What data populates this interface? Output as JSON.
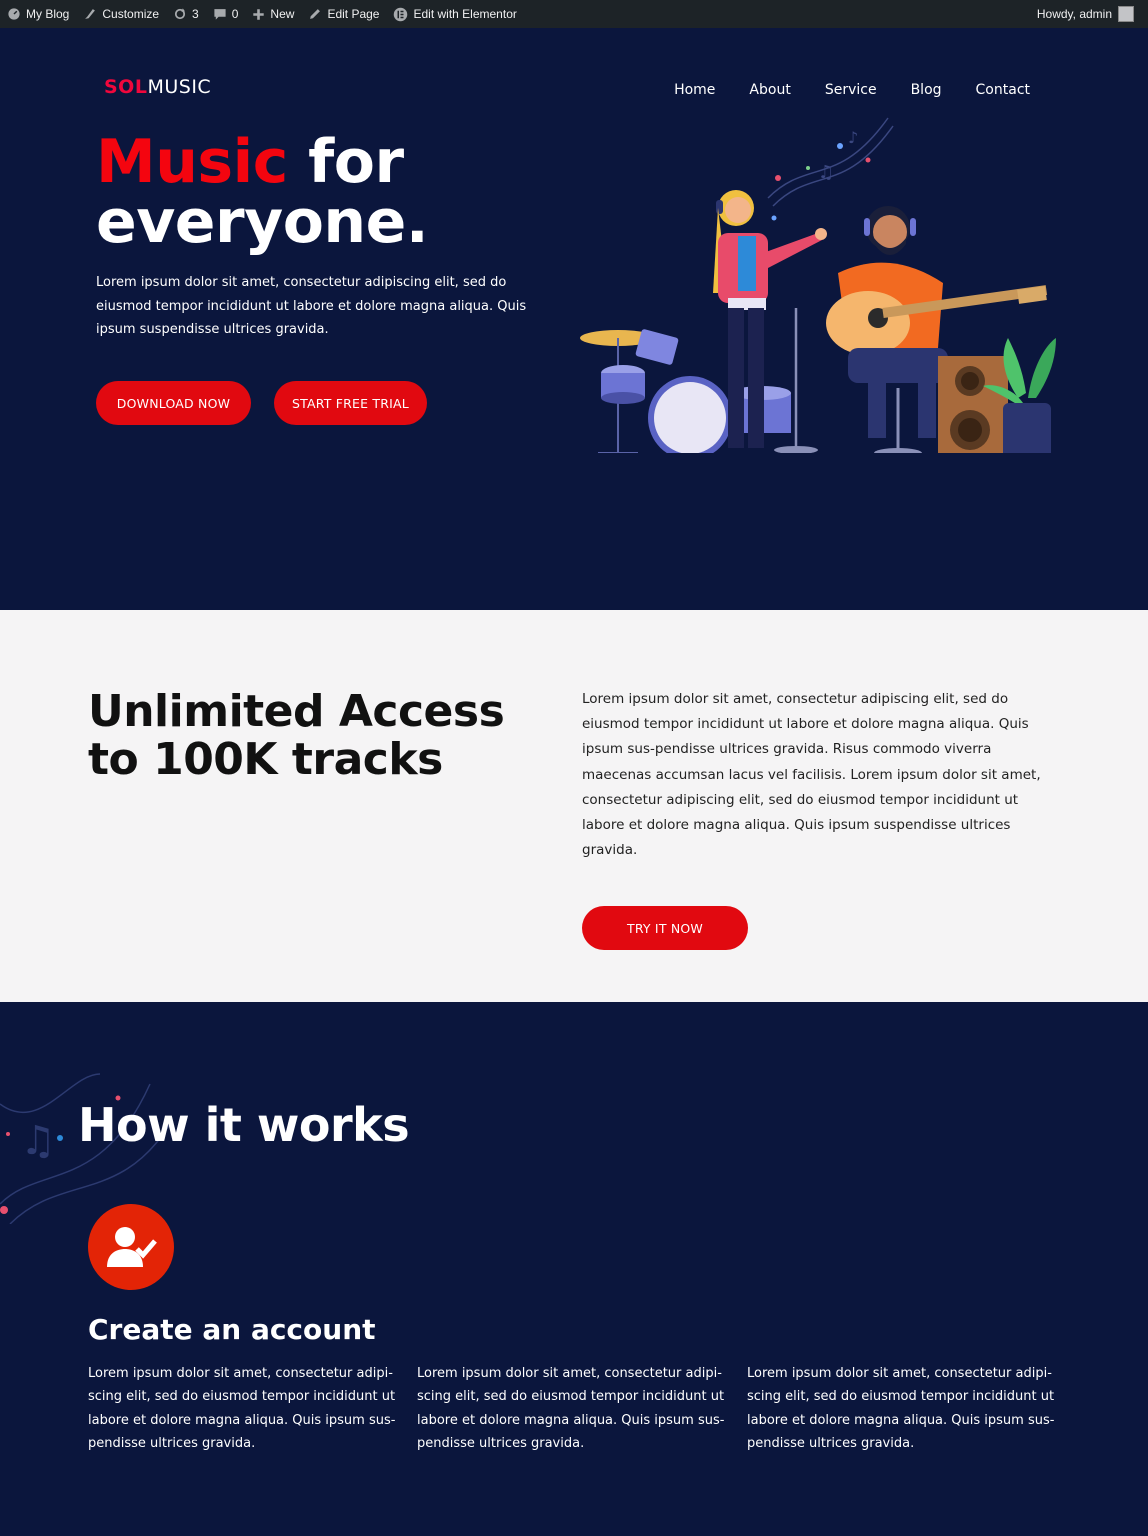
{
  "admin_bar": {
    "my_blog": "My Blog",
    "customize": "Customize",
    "updates_count": "3",
    "comments_count": "0",
    "new": "New",
    "edit_page": "Edit Page",
    "edit_elementor": "Edit with Elementor",
    "howdy": "Howdy, admin"
  },
  "header": {
    "logo_part1": "SOL",
    "logo_part2": "MUSIC",
    "nav": [
      "Home",
      "About",
      "Service",
      "Blog",
      "Contact"
    ]
  },
  "hero": {
    "title_red": "Music",
    "title_rest1": " for",
    "title_line2": "everyone.",
    "text": "Lorem ipsum dolor sit amet, consectetur adipiscing elit, sed do eiusmod tempor incididunt ut labore et dolore magna aliqua. Quis ipsum suspendisse ultrices gravida.",
    "btn_download": "DOWNLOAD NOW",
    "btn_trial": "START FREE TRIAL"
  },
  "access": {
    "title_line1": "Unlimited Access",
    "title_line2": "to 100K tracks",
    "text": "Lorem ipsum dolor sit amet, consectetur adipiscing elit, sed do eiusmod tempor incididunt ut labore et dolore magna aliqua. Quis ipsum sus-pendisse ultrices gravida. Risus commodo viverra maecenas accumsan lacus vel facilisis. Lorem ipsum dolor sit amet, consectetur adipiscing elit, sed do eiusmod tempor incididunt ut labore et dolore magna aliqua. Quis ipsum suspendisse ultrices gravida.",
    "btn_try": "TRY IT NOW"
  },
  "how": {
    "title": "How it works",
    "step_title": "Create an account",
    "columns": [
      "Lorem ipsum dolor sit amet, consectetur adipi-scing elit, sed do eiusmod tempor incididunt ut labore et dolore magna aliqua. Quis ipsum sus-pendisse ultrices gravida.",
      "Lorem ipsum dolor sit amet, consectetur adipi-scing elit, sed do eiusmod tempor incididunt ut labore et dolore magna aliqua. Quis ipsum sus-pendisse ultrices gravida.",
      "Lorem ipsum dolor sit amet, consectetur adipi-scing elit, sed do eiusmod tempor incididunt ut labore et dolore magna aliqua. Quis ipsum sus-pendisse ultrices gravida."
    ]
  },
  "colors": {
    "navy": "#0b163d",
    "red": "#e10910",
    "light_bg": "#f5f4f5"
  },
  "icons": [
    "dashboard-icon",
    "brush-icon",
    "refresh-icon",
    "comment-icon",
    "plus-icon",
    "pencil-icon",
    "elementor-icon",
    "user-check-icon"
  ]
}
